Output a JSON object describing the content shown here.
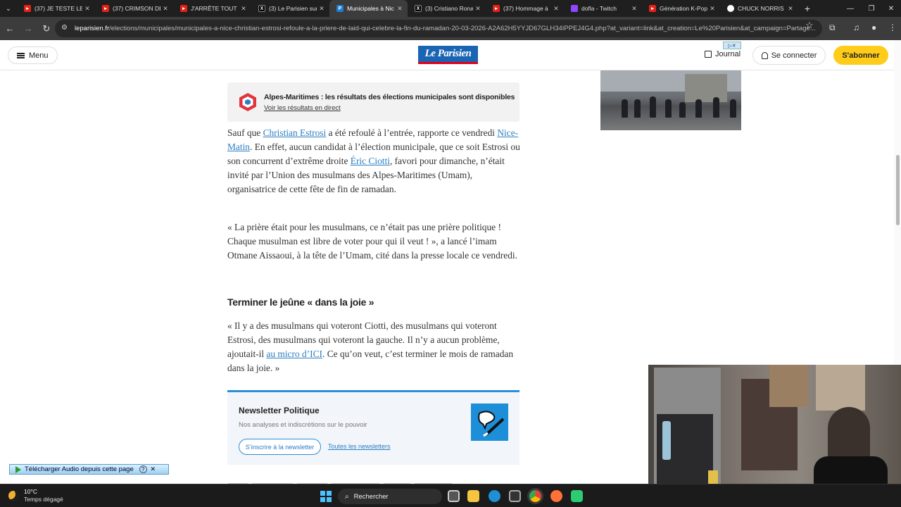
{
  "browser": {
    "tabs": [
      {
        "label": "(37) JE TESTE LE N",
        "icon": "youtube-icon"
      },
      {
        "label": "(37) CRIMSON DE",
        "icon": "youtube-icon"
      },
      {
        "label": "J'ARRÊTE TOUT ?",
        "icon": "youtube-icon"
      },
      {
        "label": "(3) Le Parisien sur",
        "icon": "x-icon"
      },
      {
        "label": "Municipales à Nic",
        "icon": "le-parisien-icon"
      },
      {
        "label": "(3) Cristiano Rona",
        "icon": "x-icon"
      },
      {
        "label": "(37) Hommage à",
        "icon": "youtube-icon"
      },
      {
        "label": "dofla - Twitch",
        "icon": "twitch-icon"
      },
      {
        "label": "Génération K-Pop",
        "icon": "youtube-icon"
      },
      {
        "label": "CHUCK NORRIS -",
        "icon": "google-icon"
      }
    ],
    "new_tab": "+",
    "url_host": "leparisien.fr",
    "url_rest": "/elections/municipales/municipales-a-nice-christian-estrosi-refoule-a-la-priere-de-laid-qui-celebre-la-fin-du-ramadan-20-03-2026-A2A62H5YYJD67GLH34IPPEJ4G4.php?at_variant=link&at_creation=Le%20Parisien&at_campaign=Partage..."
  },
  "site": {
    "menu_label": "Menu",
    "logo_text": "Le Parisien",
    "ad_badge": "▷✕",
    "journal_label": "Journal",
    "connect_label": "Se connecter",
    "subscribe_label": "S'abonner"
  },
  "results_box": {
    "title": "Alpes-Maritimes : les résultats des élections municipales sont disponibles",
    "link": "Voir les résultats en direct"
  },
  "article": {
    "p1_a": "Sauf que ",
    "p1_link1": "Christian Estrosi",
    "p1_b": " a été refoulé à l’entrée, rapporte ce vendredi ",
    "p1_link2": "Nice-Matin",
    "p1_c": ". En effet, aucun candidat à l’élection municipale, que ce soit Estrosi ou son concurrent d’extrême droite ",
    "p1_link3": "Éric Ciotti",
    "p1_d": ", favori pour dimanche, n’était invité par l’Union des musulmans des Alpes-Maritimes (Umam), organisatrice de cette fête de fin de ramadan.",
    "p2": "« La prière était pour les musulmans, ce n’était pas une prière politique ! Chaque musulman est libre de voter pour qui il veut ! », a lancé l’imam Otmane Aissaoui, à la tête de l’Umam, cité dans la presse locale ce vendredi.",
    "subhead": "Terminer le jeûne « dans la joie »",
    "p3_a": "« Il y a des musulmans qui voteront Ciotti, des musulmans qui voteront Estrosi, des musulmans qui voteront la gauche. Il n’y a aucun problème, ajoutait-il ",
    "p3_link": "au micro d’ICI",
    "p3_b": ". Ce qu’on veut, c’est terminer le mois de ramadan dans la joie. »"
  },
  "newsletter": {
    "title": "Newsletter Politique",
    "description": "Nos analyses et indiscrétions sur le pouvoir",
    "subscribe_button": "S’inscrire à la newsletter",
    "all_link": "Toutes les newsletters"
  },
  "extension_bar": {
    "label": "Télécharger Audio depuis cette page",
    "help": "?",
    "close": "✕"
  },
  "taskbar": {
    "temperature": "10°C",
    "condition": "Temps dégagé",
    "search_placeholder": "Rechercher"
  },
  "colors": {
    "accent_blue": "#2b7fc3",
    "subscribe_yellow": "#ffcc1a",
    "logo_blue": "#1a64b4"
  }
}
